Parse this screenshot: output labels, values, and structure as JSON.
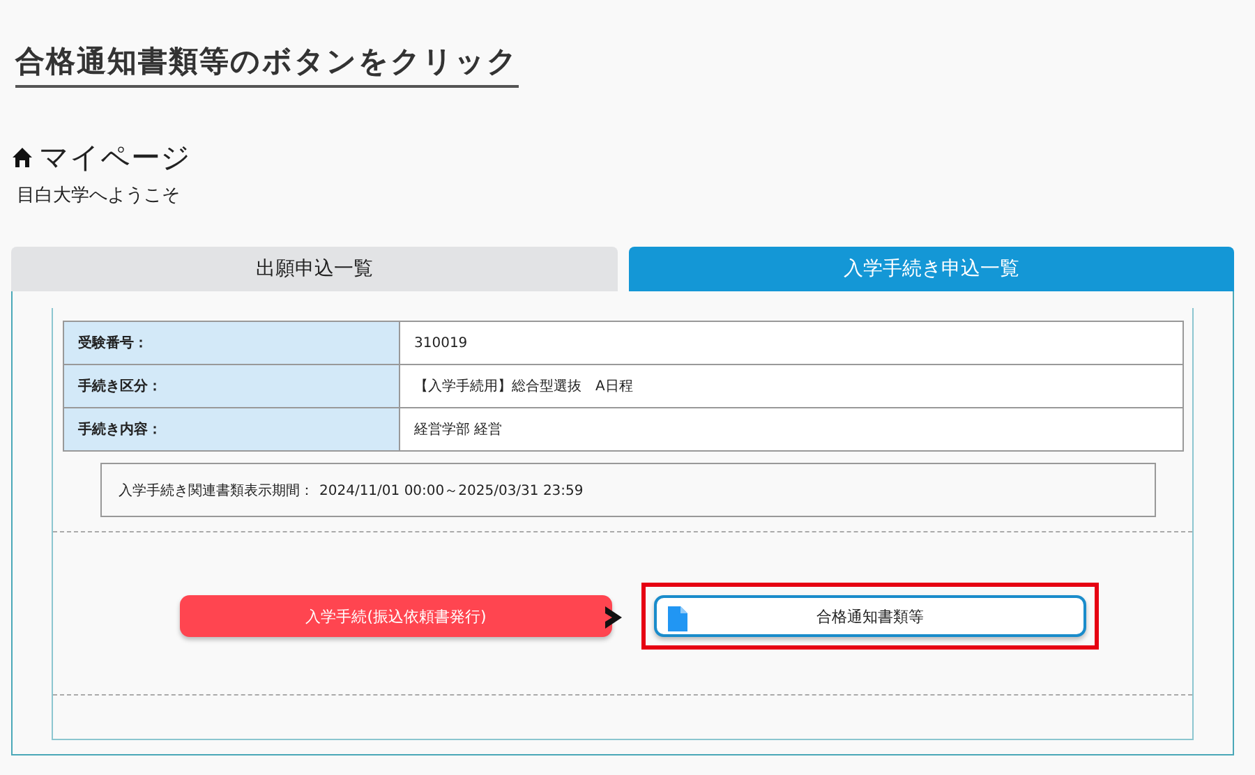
{
  "instruction": {
    "title": "合格通知書類等のボタンをクリック"
  },
  "page": {
    "title": "マイページ",
    "subtitle": "目白大学へようこそ"
  },
  "tabs": [
    {
      "label": "出願申込一覧",
      "selected": false
    },
    {
      "label": "入学手続き申込一覧",
      "selected": true
    }
  ],
  "details": [
    {
      "label": "受験番号：",
      "value": "310019"
    },
    {
      "label": "手続き区分：",
      "value": "【入学手続用】総合型選抜　A日程"
    },
    {
      "label": "手続き内容：",
      "value": "経営学部 経営"
    }
  ],
  "period": {
    "label": "入学手続き関連書類表示期間：",
    "value": "2024/11/01 00:00～2025/03/31 23:59"
  },
  "buttons": [
    {
      "kind": "primary",
      "label": "入学手続(振込依頼書発行)",
      "highlighted": false
    },
    {
      "kind": "document",
      "label": "合格通知書類等",
      "highlighted": true
    }
  ]
}
